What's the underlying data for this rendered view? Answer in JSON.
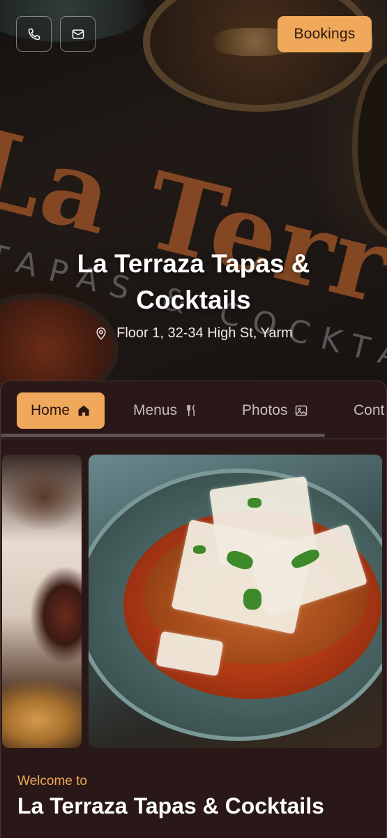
{
  "header": {
    "phone_icon": "phone-icon",
    "email_icon": "mail-icon",
    "bookings_label": "Bookings",
    "title": "La Terraza Tapas & Cocktails",
    "address": "Floor 1, 32-34 High St, Yarm",
    "background_text": "La Terraza",
    "background_subtext": "TAPAS & COCKTAILS"
  },
  "nav": {
    "tabs": [
      {
        "label": "Home",
        "icon": "home-icon",
        "active": true
      },
      {
        "label": "Menus",
        "icon": "cutlery-icon",
        "active": false
      },
      {
        "label": "Photos",
        "icon": "image-icon",
        "active": false
      },
      {
        "label": "Cont",
        "icon": "",
        "active": false
      }
    ]
  },
  "main": {
    "welcome_label": "Welcome to",
    "restaurant_name": "La Terraza Tapas & Cocktails"
  },
  "colors": {
    "accent": "#f0a85a",
    "background": "#2a1818",
    "text_primary": "#ffffff"
  }
}
